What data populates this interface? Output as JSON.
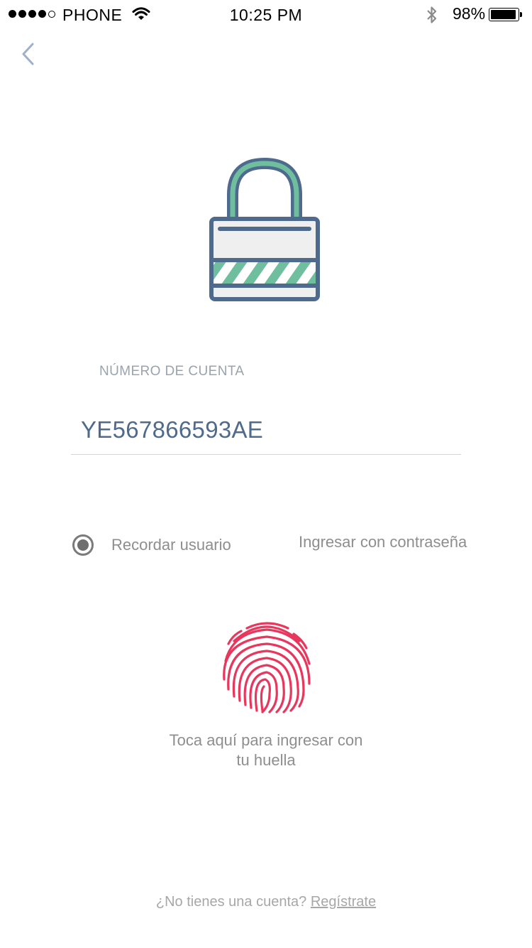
{
  "status_bar": {
    "carrier": "PHONE",
    "time": "10:25 PM",
    "battery_percent": "98%",
    "battery_level": 0.98,
    "signal_bars": 4,
    "icons": [
      "wifi-icon",
      "bluetooth-icon",
      "battery-icon"
    ]
  },
  "nav": {
    "back_icon": "chevron-left-icon"
  },
  "illustration": {
    "icon": "padlock-icon",
    "colors": {
      "outline": "#4e6a8c",
      "accent": "#6fbf9f",
      "body": "#efefef"
    }
  },
  "account": {
    "label": "NÚMERO DE CUENTA",
    "value": "YE567866593AE"
  },
  "options": {
    "remember_label": "Recordar usuario",
    "remember_selected": true,
    "password_link": "Ingresar con contraseña"
  },
  "fingerprint": {
    "icon": "fingerprint-icon",
    "color": "#e8365d",
    "caption_line1": "Toca aquí para ingresar con",
    "caption_line2": "tu huella"
  },
  "footer": {
    "question": "¿No tienes una cuenta?",
    "signup_link": "Regístrate"
  }
}
